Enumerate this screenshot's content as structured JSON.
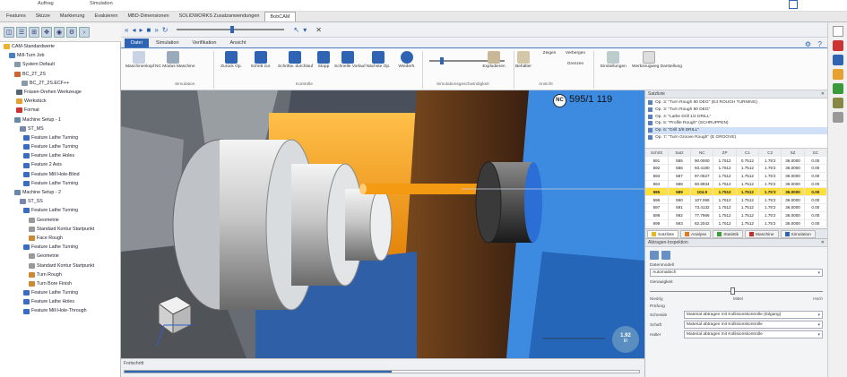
{
  "top_strip": {
    "left_label": "Auftrag",
    "center_label": "Simulation"
  },
  "command_tabs": [
    "Features",
    "Skizze",
    "Markierung",
    "Evaluieren",
    "MBD-Dimensionen",
    "SOLIDWORKS Zusatzanwendungen",
    "BobCAM"
  ],
  "tree": {
    "items": [
      {
        "label": "CAM-Standardwerte",
        "color": "#f0b030"
      },
      {
        "label": "Mill-Turn Job",
        "color": "#4a7fc4"
      },
      {
        "label": "System Default",
        "color": "#8899aa"
      },
      {
        "label": "BC_2T_2S",
        "color": "#cc6633"
      },
      {
        "label": "BC_2T_2S.ECF++",
        "color": "#8899aa"
      },
      {
        "label": "Fräsen-Drehen Werkzeuge",
        "color": "#556677"
      },
      {
        "label": "Werkstück",
        "color": "#e8a030"
      },
      {
        "label": "Format",
        "color": "#cc3333"
      },
      {
        "label": "Machine Setup - 1",
        "color": "#6688aa"
      },
      {
        "label": "ST_MS",
        "color": "#7788aa"
      },
      {
        "label": "Feature Lathe Turning",
        "color": "#3a6cc4"
      },
      {
        "label": "Feature Lathe Turning",
        "color": "#3a6cc4"
      },
      {
        "label": "Feature Lathe Holes",
        "color": "#3a6cc4"
      },
      {
        "label": "Feature 2 Axis",
        "color": "#3a6cc4"
      },
      {
        "label": "Feature Mill Hole-Blind",
        "color": "#3a6cc4"
      },
      {
        "label": "Feature Lathe Turning",
        "color": "#3a6cc4"
      },
      {
        "label": "Machine Setup - 2",
        "color": "#6688aa"
      },
      {
        "label": "ST_SS",
        "color": "#7788aa"
      },
      {
        "label": "Feature Lathe Turning",
        "color": "#3a6cc4"
      },
      {
        "label": "Geometrie",
        "color": "#999999"
      },
      {
        "label": "Standard Kontur Startpunkt",
        "color": "#999999"
      },
      {
        "label": "Face Rough",
        "color": "#cc8833"
      },
      {
        "label": "Feature Lathe Turning",
        "color": "#3a6cc4"
      },
      {
        "label": "Geometrie",
        "color": "#999999"
      },
      {
        "label": "Standard Kontur Startpunkt",
        "color": "#999999"
      },
      {
        "label": "Turn Rough",
        "color": "#cc8833"
      },
      {
        "label": "Turn Bore Finish",
        "color": "#cc8833"
      },
      {
        "label": "Feature Lathe Turning",
        "color": "#3a6cc4"
      },
      {
        "label": "Feature Lathe Holes",
        "color": "#3a6cc4"
      },
      {
        "label": "Feature Mill Hole-Through",
        "color": "#3a6cc4"
      }
    ]
  },
  "ribbon": {
    "tabs": [
      "Datei",
      "Simulation",
      "Verifikation",
      "Ansicht"
    ],
    "buttons": {
      "machine_setup": "Maschinenkopf",
      "nc_mode": "NC Modus Maschine",
      "step_back": "Zurück Op.",
      "step": "Schritt zur.",
      "forward": "Schrittw. durchlauf",
      "stop": "Stopp",
      "fast": "Schnelle Vorlauf",
      "next": "Nächste Op.",
      "repeat": "Wiederh.",
      "explode": "Explodieren",
      "container": "Behälter",
      "show": "Zeigen",
      "hide": "Verbergen",
      "limit": "Grenzen",
      "settings": "Einstellungen",
      "tool_view": "Werkzeugweg Darstellung"
    },
    "groups": {
      "simulation": "Simulation",
      "control": "Kontrolle",
      "speed": "Simulationsgeschwindigkeit",
      "view": "Ansicht"
    }
  },
  "viewport": {
    "nc_badge": "NC",
    "nc_line": "595/1 119",
    "scale_value": "1.92",
    "scale_unit": "in"
  },
  "statusbar": {
    "progress_label": "Fortschritt"
  },
  "right_panel": {
    "title": "Satzliste",
    "operations": [
      "Op. 3: \"Turn Rough 80 DEG\" (E4 ROUGH TURNING)",
      "Op. 3: \"Turn Rough 80 DEG\"",
      "Op. 4: \"Lathe Drill 1/2 DRILL\"",
      "Op. 5: \"Profile Rough\" (SCHRUPPEN)",
      "Op. 6: \"Drill 3/8 DRILL\"",
      "Op. 7: \"Turn Groove Rough\" (E GROOVE)"
    ],
    "selected_op": 4,
    "grid_headers": [
      "Schritt",
      "Satz",
      "NC",
      "ZP",
      "C1",
      "C2",
      "SZ",
      "SC"
    ],
    "grid_rows": [
      [
        "591",
        "585",
        "90.0000",
        "1.7512",
        "0.7512",
        "1.75'2",
        "36.0000",
        "0.00"
      ],
      [
        "592",
        "586",
        "93.4190",
        "1.7512",
        "1.7512",
        "1.75'2",
        "36.0000",
        "0.00"
      ],
      [
        "593",
        "587",
        "97.0527",
        "1.7512",
        "1.7512",
        "1.75'2",
        "36.0000",
        "0.00"
      ],
      [
        "594",
        "588",
        "60.8934",
        "1.7512",
        "1.7512",
        "1.75'2",
        "36.0000",
        "0.00"
      ],
      [
        "595",
        "589",
        "104.9",
        "1.7512",
        "1.7512",
        "1.75'2",
        "36.0000",
        "0.00"
      ],
      [
        "596",
        "590",
        "107.068",
        "1.7512",
        "1.7512",
        "1.75'2",
        "36.0000",
        "0.00"
      ],
      [
        "597",
        "591",
        "73.4132",
        "1.7512",
        "1.7512",
        "1.75'2",
        "36.0000",
        "0.00"
      ],
      [
        "598",
        "592",
        "77.7966",
        "1.7512",
        "1.7512",
        "1.75'2",
        "36.0000",
        "0.00"
      ],
      [
        "599",
        "593",
        "82.2042",
        "1.7512",
        "1.7512",
        "1.75'2",
        "36.0000",
        "0.00"
      ]
    ],
    "highlight_row": 4,
    "bottom_tabs": [
      "Satzliste",
      "Analyse",
      "Statistik",
      "Maschine",
      "Simulation"
    ],
    "bottom_tab_colors": [
      "#e5b820",
      "#e07a20",
      "#3aa03a",
      "#c03030",
      "#2f64b4"
    ],
    "sim_panel": {
      "title": "Abtragen-Inspektion",
      "field1_label": "Datenmodell",
      "field1_value": "Automatisch",
      "slider_label": "Genauigkeit",
      "slider_left": "Niedrig",
      "slider_mid": "Mittel",
      "slider_right": "Hoch",
      "section": "Prüfung",
      "rows": [
        {
          "k": "Schneide",
          "v": "Material abtragen mit Kollisionskontrolle (Eilgang)"
        },
        {
          "k": "Schaft",
          "v": "Material abtragen mit Kollisionskontrolle"
        },
        {
          "k": "Halter",
          "v": "Material abtragen mit Kollisionskontrolle"
        }
      ]
    }
  },
  "colors": {
    "accent": "#2f64b4",
    "highlight": "#ffe043",
    "orange": "#f39a12",
    "workpiece_blue": "#3d8be0"
  }
}
